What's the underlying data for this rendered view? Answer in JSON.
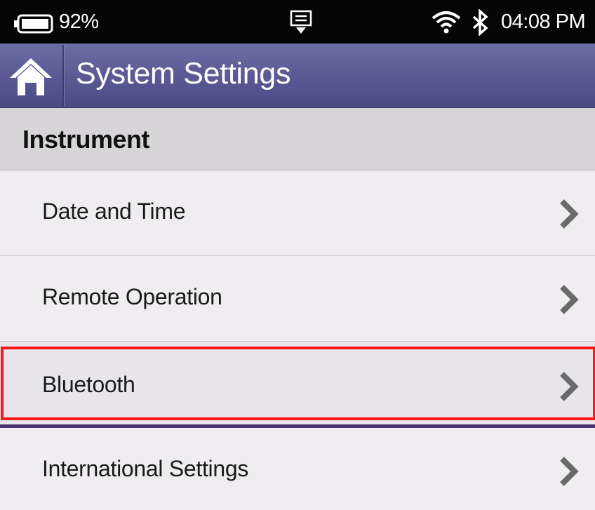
{
  "status_bar": {
    "battery_percent": "92%",
    "time": "04:08 PM",
    "icons": [
      "battery-icon",
      "notification-icon",
      "wifi-icon",
      "bluetooth-icon"
    ]
  },
  "header": {
    "title": "System Settings",
    "home_icon": "home-icon",
    "colors": {
      "header_top": "#6d6ea6",
      "header_bottom": "#4a4b84"
    }
  },
  "section": {
    "title": "Instrument"
  },
  "menu": {
    "items": [
      {
        "label": "Date and Time",
        "icon": "chevron-right-icon"
      },
      {
        "label": "Remote Operation",
        "icon": "chevron-right-icon"
      },
      {
        "label": "Bluetooth",
        "icon": "chevron-right-icon",
        "highlighted": true
      },
      {
        "label": "International Settings",
        "icon": "chevron-right-icon"
      }
    ]
  },
  "highlight_color": "#ff1616"
}
